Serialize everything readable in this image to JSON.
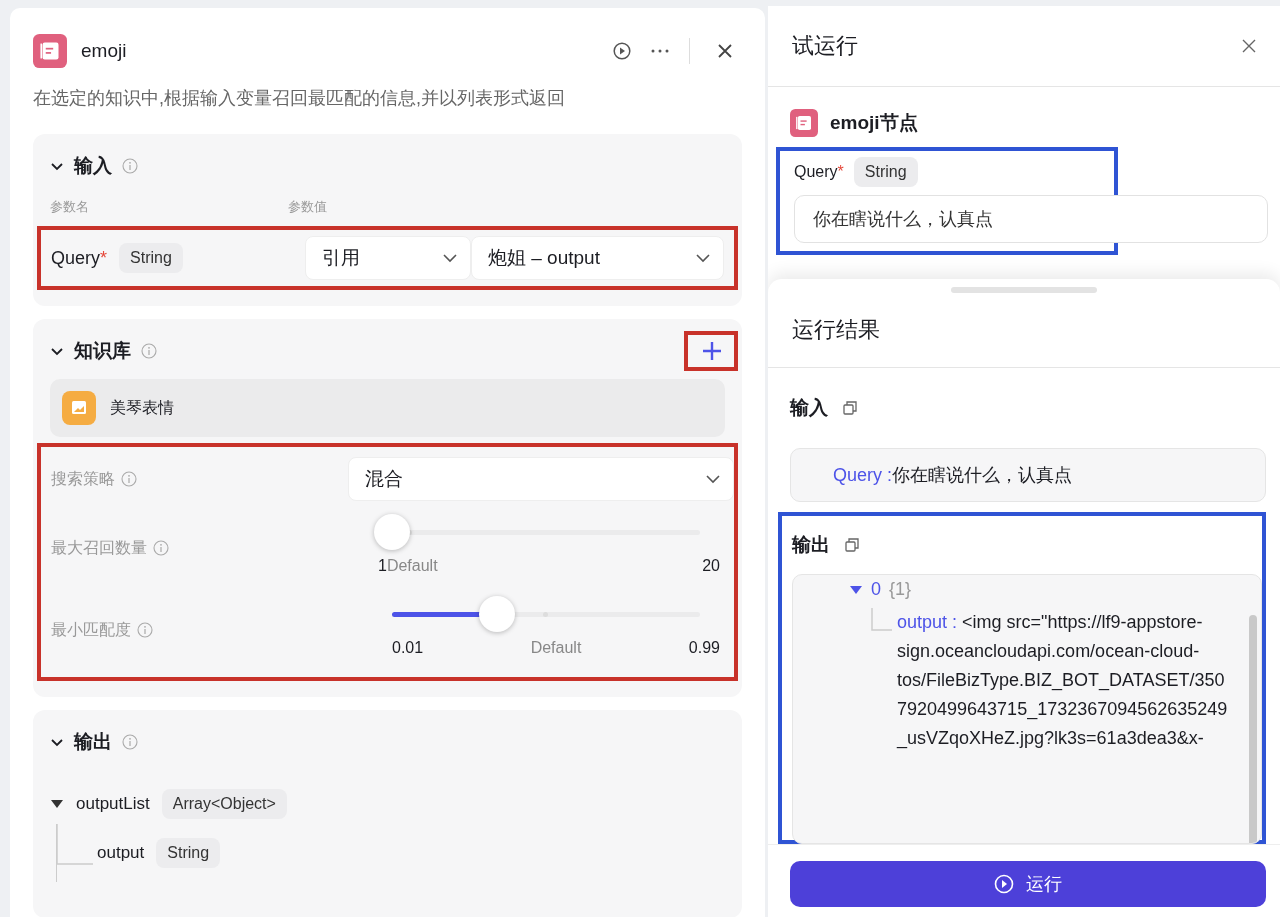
{
  "node": {
    "title": "emoji",
    "description": "在选定的知识中,根据输入变量召回最匹配的信息,并以列表形式返回"
  },
  "input_section": {
    "title": "输入",
    "expanded": true,
    "columns": [
      "参数名",
      "参数值"
    ],
    "params": [
      {
        "name": "Query",
        "required_mark": "*",
        "type": "String",
        "source": "引用",
        "value": "炮姐 – output"
      }
    ]
  },
  "knowledge_section": {
    "title": "知识库",
    "expanded": true,
    "items": [
      {
        "name": "美琴表情"
      }
    ],
    "strategy": {
      "label": "搜索策略",
      "value": "混合"
    },
    "sliders": [
      {
        "kind": "count",
        "label": "最大召回数量",
        "level": 0,
        "min": "1",
        "default": "Default",
        "max": "20"
      },
      {
        "kind": "score",
        "label": "最小匹配度",
        "level": 0.34,
        "min": "0.01",
        "default": "Default",
        "max": "0.99"
      }
    ]
  },
  "output_section": {
    "title": "输出",
    "expanded": true,
    "tree": [
      {
        "name": "outputList",
        "type": "Array<Object>",
        "expanded": true,
        "children": [
          {
            "name": "output",
            "type": "String"
          }
        ]
      }
    ]
  },
  "test_run": {
    "title": "试运行",
    "node_name": "emoji节点",
    "fields": [
      {
        "name": "Query",
        "required_mark": "*",
        "type": "String",
        "value": "你在瞎说什么，认真点"
      }
    ]
  },
  "result": {
    "title": "运行结果",
    "input_label": "输入",
    "input_lines": [
      {
        "key": "Query :",
        "value": "你在瞎说什么，认真点"
      }
    ],
    "output_label": "输出",
    "output_node": {
      "key": "0",
      "count": "{1}",
      "expanded": true,
      "entries": [
        {
          "key": "output :",
          "value": "<img src=\"https://lf9-appstore-sign.oceancloudapi.com/ocean-cloud-tos/FileBizType.BIZ_BOT_DATASET/3507920499643715_1732367094562635249_usVZqoXHeZ.jpg?lk3s=61a3dea3&x-"
        }
      ]
    }
  },
  "run_button": "运行"
}
